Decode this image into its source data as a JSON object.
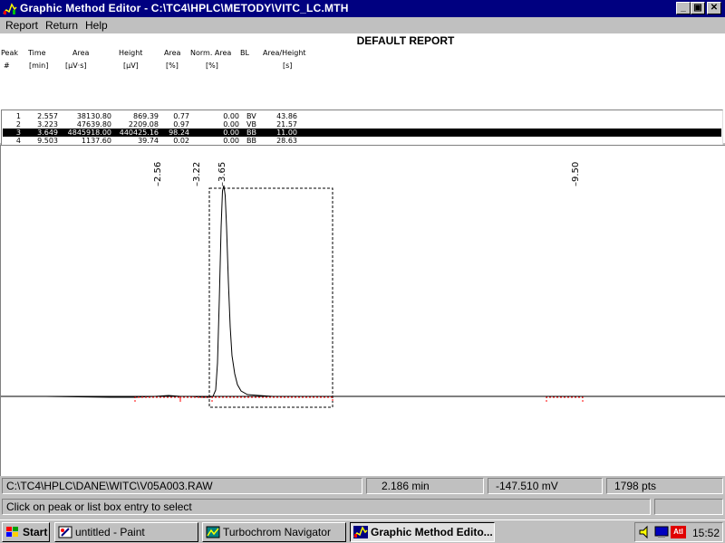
{
  "window": {
    "title": "Graphic Method Editor  -  C:\\TC4\\HPLC\\METODY\\VITC_LC.MTH",
    "min_glyph": "_",
    "max_glyph": "▣",
    "close_glyph": "✕"
  },
  "menu": [
    "Report",
    "Return",
    "Help"
  ],
  "report": {
    "title": "DEFAULT REPORT",
    "headers": {
      "peak": [
        "Peak",
        "#"
      ],
      "time": [
        "Time",
        "[min]"
      ],
      "area": [
        "Area",
        "[μV·s]"
      ],
      "height": [
        "Height",
        "[μV]"
      ],
      "area_pct": [
        "Area",
        "[%]"
      ],
      "norm_area": [
        "Norm. Area",
        "[%]"
      ],
      "bl": [
        "BL",
        ""
      ],
      "area_height": [
        "Area/Height",
        "[s]"
      ]
    },
    "rows": [
      {
        "peak": "1",
        "time": "2.557",
        "area": "38130.80",
        "height": "869.39",
        "area_pct": "0.77",
        "norm_area": "0.00",
        "bl": "BV",
        "area_height": "43.86",
        "selected": false
      },
      {
        "peak": "2",
        "time": "3.223",
        "area": "47639.80",
        "height": "2209.08",
        "area_pct": "0.97",
        "norm_area": "0.00",
        "bl": "VB",
        "area_height": "21.57",
        "selected": false
      },
      {
        "peak": "3",
        "time": "3.649",
        "area": "4845918.00",
        "height": "440425.16",
        "area_pct": "98.24",
        "norm_area": "0.00",
        "bl": "BB",
        "area_height": "11.00",
        "selected": true
      },
      {
        "peak": "4",
        "time": "9.503",
        "area": "1137.60",
        "height": "39.74",
        "area_pct": "0.02",
        "norm_area": "0.00",
        "bl": "BB",
        "area_height": "28.63",
        "selected": false
      }
    ]
  },
  "chromatogram": {
    "peak_labels": [
      {
        "text": "2.56",
        "time": 2.557
      },
      {
        "text": "3.22",
        "time": 3.223
      },
      {
        "text": "3.65",
        "time": 3.649
      },
      {
        "text": "9.50",
        "time": 9.503
      }
    ],
    "trace_color": "#000000",
    "baseline_color": "#ff0000"
  },
  "status": {
    "file": "C:\\TC4\\HPLC\\DANE\\WITC\\V05A003.RAW",
    "time": "2.186 min",
    "signal": "-147.510 mV",
    "points": "1798 pts",
    "hint": "Click on peak or list box entry to select"
  },
  "taskbar": {
    "start": "Start",
    "tasks": [
      {
        "label": "untitled - Paint",
        "active": false
      },
      {
        "label": "Turbochrom Navigator",
        "active": false
      },
      {
        "label": "Graphic Method Edito...",
        "active": true
      }
    ],
    "tray_badge": "Atl",
    "clock": "15:52"
  }
}
